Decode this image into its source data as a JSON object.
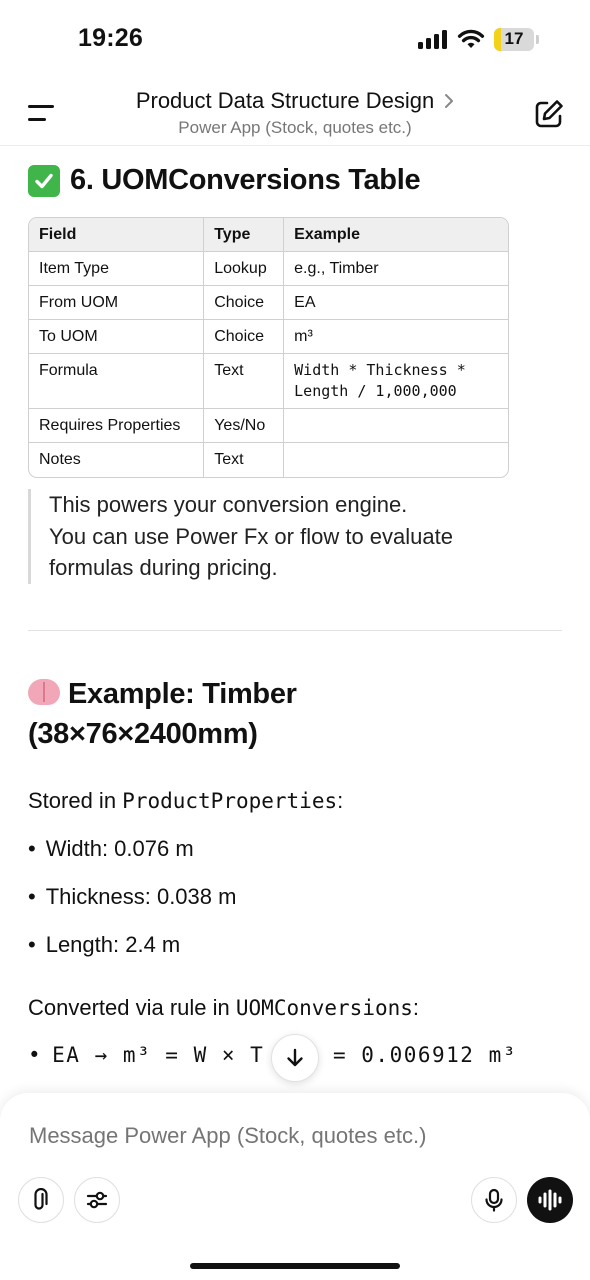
{
  "status_bar": {
    "time": "19:26",
    "battery_level": "17",
    "battery_fraction": 0.17
  },
  "header": {
    "title": "Product Data Structure Design",
    "subtitle": "Power App (Stock, quotes etc.)"
  },
  "section1": {
    "heading": "6. UOMConversions Table",
    "heading_icon": "check-mark-emoji",
    "table": {
      "columns": [
        "Field",
        "Type",
        "Example"
      ],
      "rows": [
        [
          "Item Type",
          "Lookup",
          "e.g., Timber"
        ],
        [
          "From UOM",
          "Choice",
          "EA"
        ],
        [
          "To UOM",
          "Choice",
          "m³"
        ],
        [
          "Formula",
          "Text",
          "Width * Thickness * Length / 1,000,000"
        ],
        [
          "Requires Properties",
          "Yes/No",
          ""
        ],
        [
          "Notes",
          "Text",
          ""
        ]
      ]
    },
    "quote_lines": [
      "This powers your conversion engine.",
      "You can use Power Fx or flow to evaluate",
      "formulas during pricing."
    ]
  },
  "section2": {
    "heading_line1": "Example: Timber",
    "heading_line2": "(38×76×2400mm)",
    "heading_icon": "brain-emoji",
    "stored_in_prefix": "Stored in ",
    "stored_in_code": "ProductProperties",
    "stored_in_suffix": ":",
    "bullets": [
      "Width: 0.076 m",
      "Thickness: 0.038 m",
      "Length: 2.4 m"
    ],
    "converted_prefix": "Converted via rule in ",
    "converted_code": "UOMConversions",
    "converted_suffix": ":",
    "formula_left": "EA → m³ = W × T",
    "formula_right": "= 0.006912 m³"
  },
  "composer": {
    "placeholder": "Message Power App (Stock, quotes etc.)"
  },
  "icons": {
    "menu": "menu-icon",
    "edit": "new-chat-icon",
    "attach": "paperclip-icon",
    "tools": "sliders-icon",
    "mic": "microphone-icon",
    "voice": "voice-mode-icon",
    "scroll": "arrow-down-icon"
  }
}
